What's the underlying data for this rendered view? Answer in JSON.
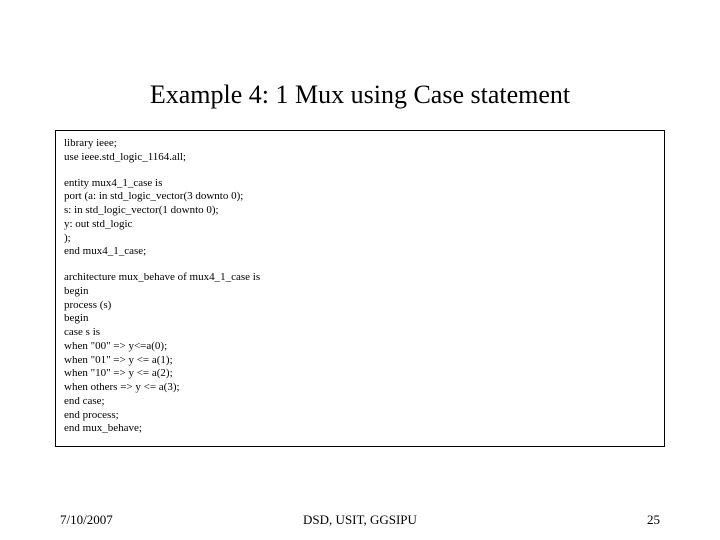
{
  "title": "Example 4: 1 Mux using Case statement",
  "code": {
    "l1": "library ieee;",
    "l2": "use ieee.std_logic_1164.all;",
    "l3": "entity mux4_1_case is",
    "l4": "port (a: in std_logic_vector(3 downto 0);",
    "l5": "s: in std_logic_vector(1 downto 0);",
    "l6": "y: out std_logic",
    "l7": ");",
    "l8": "end mux4_1_case;",
    "l9": "architecture mux_behave of mux4_1_case is",
    "l10": "begin",
    "l11": "process (s)",
    "l12": "begin",
    "l13": "case s is",
    "l14": "when \"00\" => y<=a(0);",
    "l15": "when \"01\" => y <= a(1);",
    "l16": "when \"10\" => y <= a(2);",
    "l17": "when others => y <= a(3);",
    "l18": "end case;",
    "l19": "end process;",
    "l20": "end mux_behave;"
  },
  "footer": {
    "date": "7/10/2007",
    "center": "DSD, USIT, GGSIPU",
    "page": "25"
  }
}
